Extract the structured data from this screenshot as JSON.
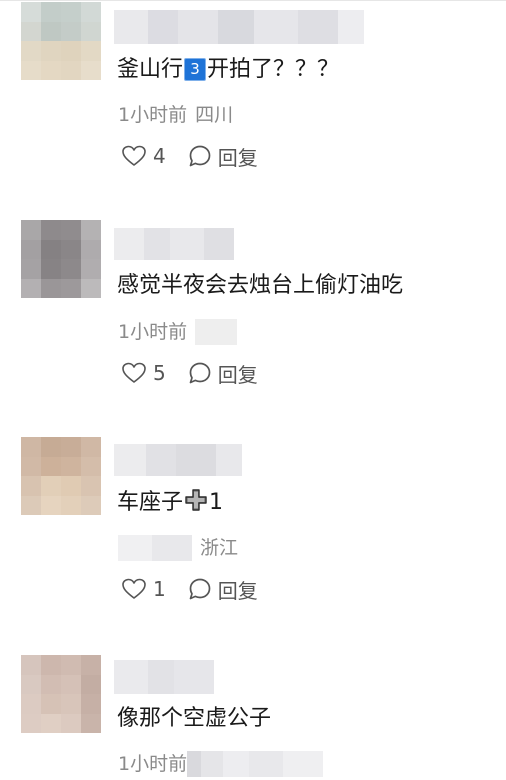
{
  "comments": [
    {
      "text_before": "釜山行",
      "badge": "3",
      "text_after": "开拍了？？？",
      "time": "1小时前",
      "location": "四川",
      "likes": "4",
      "reply_label": "回复"
    },
    {
      "text": "感觉半夜会去烛台上偷灯油吃",
      "time": "1小时前",
      "location": "",
      "likes": "5",
      "reply_label": "回复"
    },
    {
      "text_before": "车座子",
      "emoji_icon": "heavy-plus-icon",
      "text_after": "1",
      "time": "",
      "location": "浙江",
      "likes": "1",
      "reply_label": "回复"
    },
    {
      "text": "像那个空虚公子",
      "time": "1小时前",
      "location": ""
    }
  ],
  "colors": {
    "badge_blue": "#1e73d7",
    "meta_gray": "#8a8a8a",
    "text_dark": "#1a1a1a"
  }
}
